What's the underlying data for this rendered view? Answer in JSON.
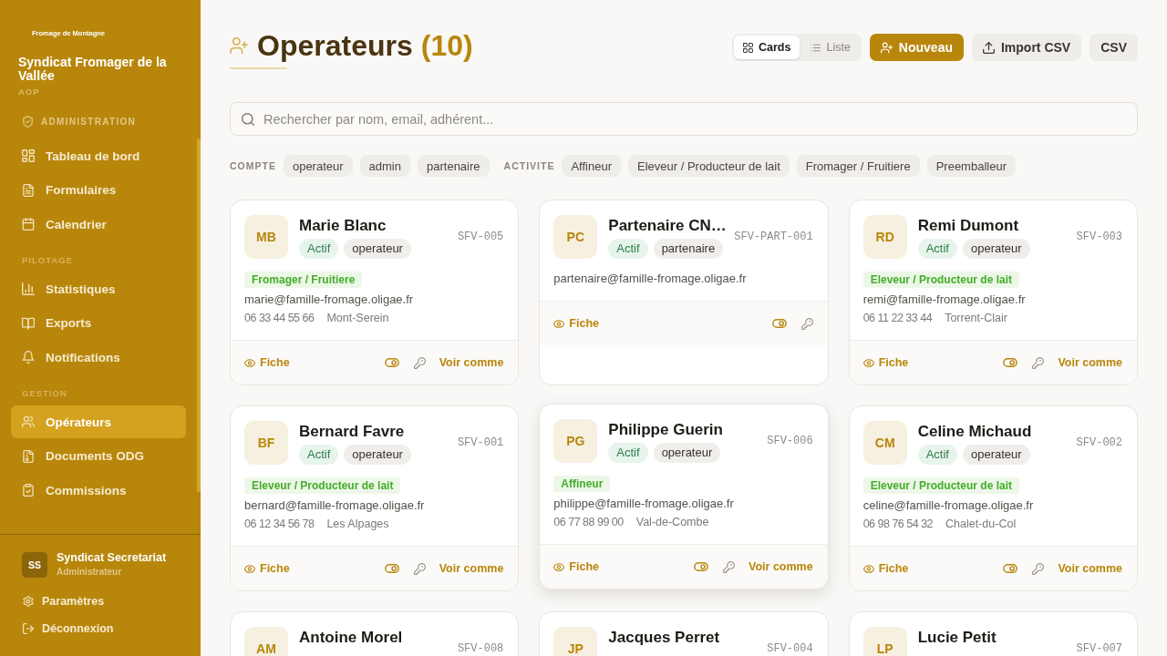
{
  "sidebar": {
    "logo_text": "Fromage de Montagne",
    "org_name": "Syndicat Fromager de la Vallée",
    "org_tag": "AOP",
    "sections": [
      {
        "kind": "module",
        "label": "ADMINISTRATION",
        "items": [
          {
            "label": "Tableau de bord",
            "selected": false
          },
          {
            "label": "Formulaires",
            "selected": false
          },
          {
            "label": "Calendrier",
            "selected": false
          }
        ]
      },
      {
        "kind": "group",
        "label": "PILOTAGE",
        "items": [
          {
            "label": "Statistiques",
            "selected": false
          },
          {
            "label": "Exports",
            "selected": false
          },
          {
            "label": "Notifications",
            "selected": false
          }
        ]
      },
      {
        "kind": "group",
        "label": "GESTION",
        "items": [
          {
            "label": "Opérateurs",
            "selected": true
          },
          {
            "label": "Documents ODG",
            "selected": false
          },
          {
            "label": "Commissions",
            "selected": false
          }
        ]
      }
    ],
    "user": {
      "initials": "SS",
      "name": "Syndicat Secretariat",
      "role": "Administrateur"
    },
    "footer_links": [
      "Paramètres",
      "Déconnexion"
    ]
  },
  "header": {
    "title": "Operateurs",
    "count": "(10)",
    "view_toggle": [
      {
        "label": "Cards",
        "selected": true
      },
      {
        "label": "Liste",
        "selected": false
      }
    ],
    "buttons": [
      {
        "label": "Nouveau",
        "kind": "primary"
      },
      {
        "label": "Import CSV",
        "kind": "secondary"
      },
      {
        "label": "CSV",
        "kind": "secondary"
      }
    ]
  },
  "search": {
    "placeholder": "Rechercher par nom, email, adhérent..."
  },
  "filters": [
    {
      "label": "COMPTE",
      "options": [
        {
          "label": "operateur",
          "selected": false
        },
        {
          "label": "admin",
          "selected": false
        },
        {
          "label": "partenaire",
          "selected": false
        }
      ]
    },
    {
      "label": "ACTIVITE",
      "options": [
        {
          "label": "Affineur",
          "selected": false
        },
        {
          "label": "Eleveur / Producteur de lait",
          "selected": false
        },
        {
          "label": "Fromager / Fruitiere",
          "selected": false
        },
        {
          "label": "Preemballeur",
          "selected": false
        }
      ]
    }
  ],
  "cards": [
    {
      "initials": "MB",
      "name": "Marie Blanc",
      "status": "Actif",
      "role": "operateur",
      "code": "SFV-005",
      "activity": "Fromager / Fruitiere",
      "email": "marie@famille-fromage.oligae.fr",
      "phone": "06 33 44 55 66",
      "city": "Mont-Serein",
      "view_link": "Fiche",
      "view_as_link": "Voir comme",
      "hovered": false
    },
    {
      "initials": "PC",
      "name": "Partenaire CN…",
      "status": "Actif",
      "role": "partenaire",
      "code": "SFV-PART-001",
      "email": "partenaire@famille-fromage.oligae.fr",
      "view_link": "Fiche",
      "hovered": false
    },
    {
      "initials": "RD",
      "name": "Remi Dumont",
      "status": "Actif",
      "role": "operateur",
      "code": "SFV-003",
      "activity": "Eleveur / Producteur de lait",
      "email": "remi@famille-fromage.oligae.fr",
      "phone": "06 11 22 33 44",
      "city": "Torrent-Clair",
      "view_link": "Fiche",
      "view_as_link": "Voir comme",
      "hovered": false
    },
    {
      "initials": "BF",
      "name": "Bernard Favre",
      "status": "Actif",
      "role": "operateur",
      "code": "SFV-001",
      "activity": "Eleveur / Producteur de lait",
      "email": "bernard@famille-fromage.oligae.fr",
      "phone": "06 12 34 56 78",
      "city": "Les Alpages",
      "view_link": "Fiche",
      "view_as_link": "Voir comme",
      "hovered": false
    },
    {
      "initials": "PG",
      "name": "Philippe Guerin",
      "status": "Actif",
      "role": "operateur",
      "code": "SFV-006",
      "activity": "Affineur",
      "email": "philippe@famille-fromage.oligae.fr",
      "phone": "06 77 88 99 00",
      "city": "Val-de-Combe",
      "view_link": "Fiche",
      "view_as_link": "Voir comme",
      "hovered": true
    },
    {
      "initials": "CM",
      "name": "Celine Michaud",
      "status": "Actif",
      "role": "operateur",
      "code": "SFV-002",
      "activity": "Eleveur / Producteur de lait",
      "email": "celine@famille-fromage.oligae.fr",
      "phone": "06 98 76 54 32",
      "city": "Chalet-du-Col",
      "view_link": "Fiche",
      "view_as_link": "Voir comme",
      "hovered": false
    },
    {
      "initials": "AM",
      "name": "Antoine Morel",
      "code": "SFV-008",
      "hovered": false
    },
    {
      "initials": "JP",
      "name": "Jacques Perret",
      "code": "SFV-004",
      "hovered": false
    },
    {
      "initials": "LP",
      "name": "Lucie Petit",
      "code": "SFV-007",
      "hovered": false
    }
  ]
}
